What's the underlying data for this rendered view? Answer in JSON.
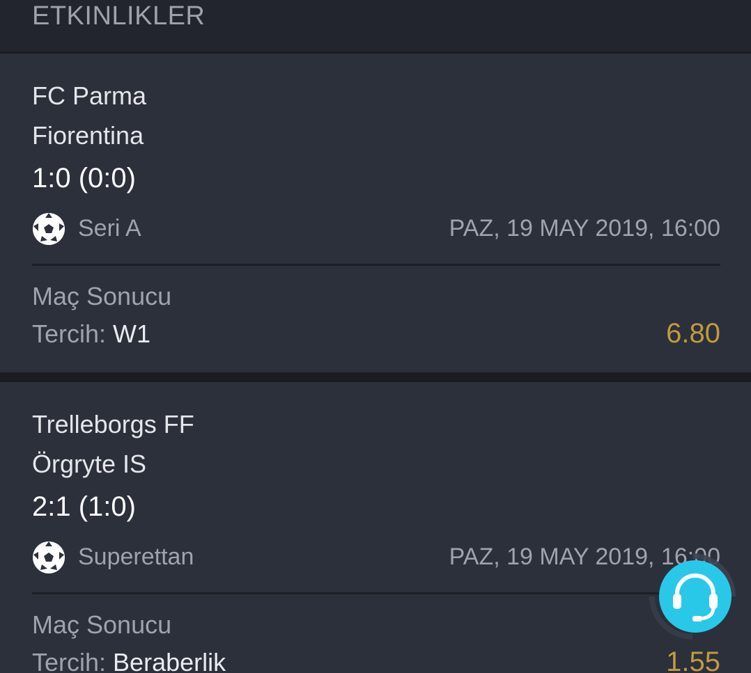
{
  "header": {
    "title": "ETKINLIKLER"
  },
  "events": [
    {
      "home": "FC Parma",
      "away": "Fiorentina",
      "score": "1:0 (0:0)",
      "league": "Seri A",
      "sport_icon": "soccer-ball-icon",
      "datetime": "PAZ, 19 MAY 2019, 16:00",
      "market": "Maç Sonucu",
      "pick_label": "Tercih:",
      "pick_value": "W1",
      "odds": "6.80"
    },
    {
      "home": "Trelleborgs FF",
      "away": "Örgryte IS",
      "score": "2:1 (1:0)",
      "league": "Superettan",
      "sport_icon": "soccer-ball-icon",
      "datetime": "PAZ, 19 MAY 2019, 16:00",
      "market": "Maç Sonucu",
      "pick_label": "Tercih:",
      "pick_value": "Beraberlik",
      "odds": "1.55"
    }
  ],
  "support": {
    "icon": "headset-icon"
  },
  "colors": {
    "background": "#2c303b",
    "header": "#22252e",
    "odds": "#c29a3f",
    "support_accent": "#29c8e8"
  }
}
